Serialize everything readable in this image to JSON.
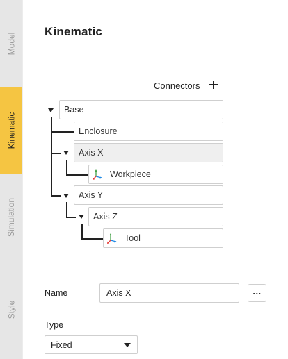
{
  "tabs": [
    {
      "label": "Model"
    },
    {
      "label": "Kinematic"
    },
    {
      "label": "Simulation"
    },
    {
      "label": "Style"
    }
  ],
  "panel": {
    "title": "Kinematic",
    "connectors_label": "Connectors"
  },
  "tree": {
    "base": "Base",
    "enclosure": "Enclosure",
    "axis_x": "Axis X",
    "workpiece": "Workpiece",
    "axis_y": "Axis Y",
    "axis_z": "Axis Z",
    "tool": "Tool"
  },
  "properties": {
    "name_label": "Name",
    "name_value": "Axis X",
    "more_label": "...",
    "type_label": "Type",
    "type_value": "Fixed"
  },
  "colors": {
    "active_tab": "#f5c542",
    "axis_x": "#e53935",
    "axis_y": "#43a047",
    "axis_z": "#1e88e5"
  },
  "icons": {
    "add": "plus-icon",
    "connector": "coordinate-axes-icon",
    "expand": "caret-down-icon"
  }
}
